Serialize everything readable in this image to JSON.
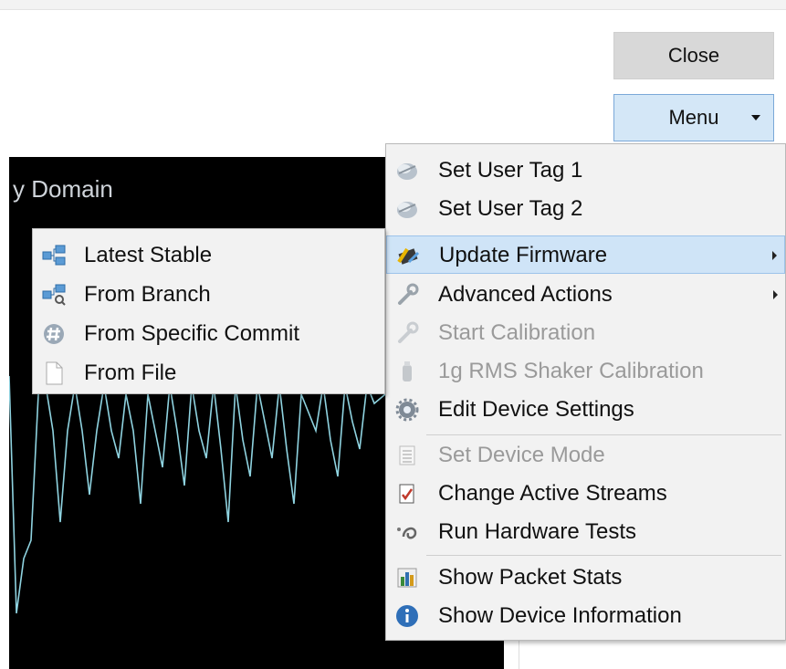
{
  "buttons": {
    "close_label": "Close",
    "menu_label": "Menu"
  },
  "plot": {
    "title": "y Domain",
    "background": "#000000",
    "line_color": "#8fd3e0"
  },
  "context_menu": {
    "items": [
      {
        "label": "Set User Tag 1",
        "icon": "tag-icon",
        "enabled": true
      },
      {
        "label": "Set User Tag 2",
        "icon": "tag-icon",
        "enabled": true
      },
      {
        "label": "Update Firmware",
        "icon": "firmware-chip-icon",
        "enabled": true,
        "submenu": true,
        "highlighted": true
      },
      {
        "label": "Advanced Actions",
        "icon": "wrench-icon",
        "enabled": true,
        "submenu": true
      },
      {
        "label": "Start Calibration",
        "icon": "calibration-wrench-icon",
        "enabled": false
      },
      {
        "label": "1g RMS Shaker Calibration",
        "icon": "shaker-icon",
        "enabled": false
      },
      {
        "label": "Edit Device Settings",
        "icon": "gear-icon",
        "enabled": true
      },
      {
        "label": "Set Device Mode",
        "icon": "list-icon",
        "enabled": false
      },
      {
        "label": "Change Active Streams",
        "icon": "streams-icon",
        "enabled": true
      },
      {
        "label": "Run Hardware Tests",
        "icon": "hardware-test-icon",
        "enabled": true
      },
      {
        "label": "Show Packet Stats",
        "icon": "bar-chart-icon",
        "enabled": true
      },
      {
        "label": "Show Device Information",
        "icon": "info-icon",
        "enabled": true
      }
    ]
  },
  "firmware_submenu": {
    "items": [
      {
        "label": "Latest Stable",
        "icon": "branch-tree-icon"
      },
      {
        "label": "From Branch",
        "icon": "branch-search-icon"
      },
      {
        "label": "From Specific Commit",
        "icon": "commit-hash-icon"
      },
      {
        "label": "From File",
        "icon": "file-icon"
      }
    ]
  },
  "colors": {
    "highlight": "#cfe4f7",
    "menu_bg": "#f2f2f2",
    "menu_button_bg": "#d4e7f7"
  }
}
